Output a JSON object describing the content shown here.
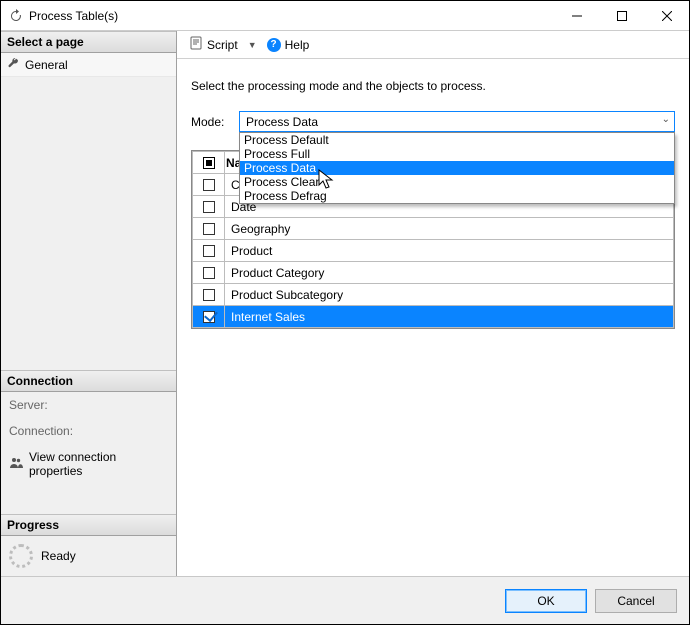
{
  "window": {
    "title": "Process Table(s)"
  },
  "sidebar": {
    "select_page_header": "Select a page",
    "pages": [
      {
        "label": "General"
      }
    ],
    "connection_header": "Connection",
    "server_label": "Server:",
    "server_value": "",
    "connection_label": "Connection:",
    "connection_value": "",
    "view_conn_props": "View connection properties",
    "progress_header": "Progress",
    "progress_status": "Ready"
  },
  "toolbar": {
    "script_label": "Script",
    "help_label": "Help"
  },
  "content": {
    "instruction": "Select the processing mode and the objects to process.",
    "mode_label": "Mode:",
    "mode_selected": "Process Data",
    "mode_options": [
      "Process Default",
      "Process Full",
      "Process Data",
      "Process Clear",
      "Process Defrag"
    ],
    "mode_highlight_index": 2,
    "table": {
      "name_header": "Name",
      "rows": [
        {
          "name": "Customer",
          "checked": false,
          "selected": false
        },
        {
          "name": "Date",
          "checked": false,
          "selected": false
        },
        {
          "name": "Geography",
          "checked": false,
          "selected": false
        },
        {
          "name": "Product",
          "checked": false,
          "selected": false
        },
        {
          "name": "Product Category",
          "checked": false,
          "selected": false
        },
        {
          "name": "Product Subcategory",
          "checked": false,
          "selected": false
        },
        {
          "name": "Internet Sales",
          "checked": true,
          "selected": true
        }
      ]
    }
  },
  "buttons": {
    "ok": "OK",
    "cancel": "Cancel"
  }
}
